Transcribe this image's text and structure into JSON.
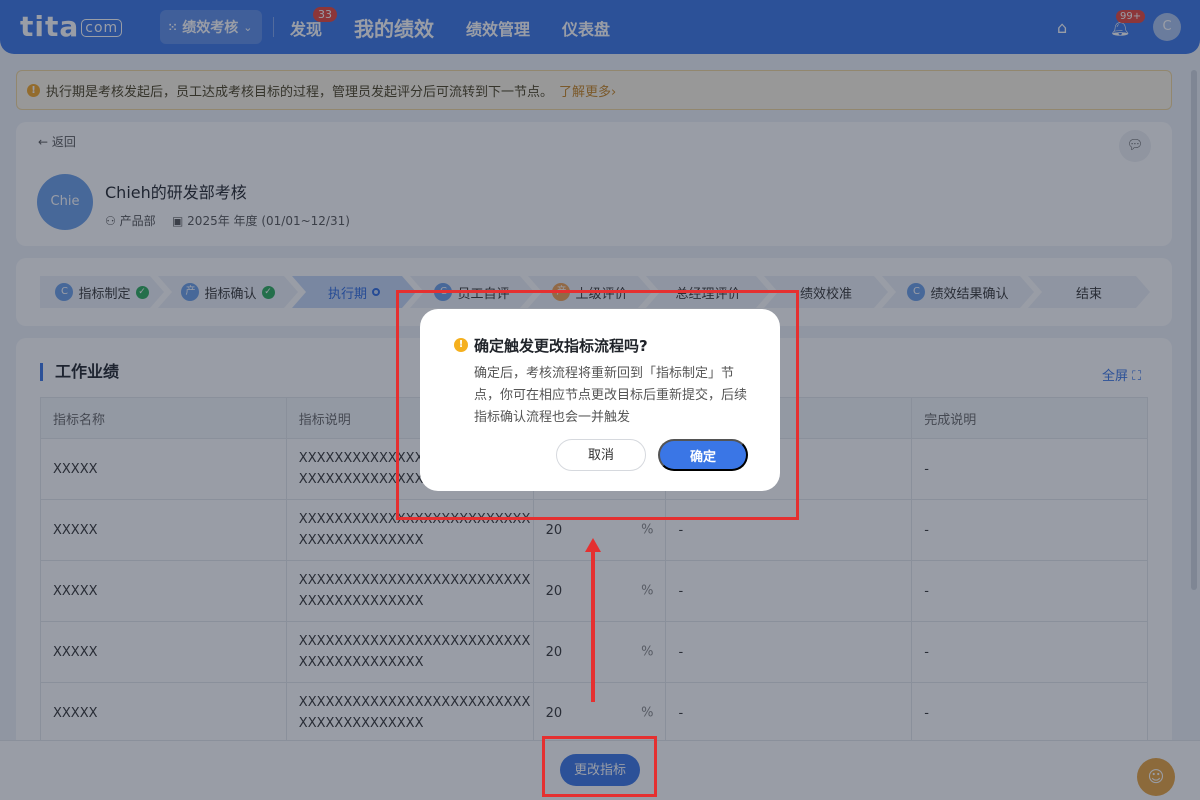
{
  "header": {
    "logo": "tita",
    "logo_suffix": "com",
    "module": "绩效考核",
    "nav": [
      "发现",
      "我的绩效",
      "绩效管理",
      "仪表盘"
    ],
    "discover_badge": "33",
    "bell_badge": "99+",
    "user_initial": "C"
  },
  "notice": {
    "text": "执行期是考核发起后，员工达成考核目标的过程，管理员发起评分后可流转到下一节点。",
    "link": "了解更多"
  },
  "info": {
    "back": "返回",
    "avatar": "Chie",
    "title": "Chieh的研发部考核",
    "department": "产品部",
    "period": "2025年 年度 (01/01~12/31)"
  },
  "steps": [
    {
      "label": "指标制定",
      "avatar": "C",
      "status": "done"
    },
    {
      "label": "指标确认",
      "avatar": "产",
      "status": "done"
    },
    {
      "label": "执行期",
      "avatar": "",
      "status": "current"
    },
    {
      "label": "员工自评",
      "avatar": "C",
      "status": ""
    },
    {
      "label": "上级评价",
      "avatar": "产",
      "status": ""
    },
    {
      "label": "总经理评价",
      "avatar": "",
      "status": ""
    },
    {
      "label": "绩效校准",
      "avatar": "",
      "status": ""
    },
    {
      "label": "绩效结果确认",
      "avatar": "C",
      "status": ""
    },
    {
      "label": "结束",
      "avatar": "",
      "status": ""
    }
  ],
  "section": {
    "title": "工作业绩",
    "fullscreen": "全屏"
  },
  "table": {
    "columns": [
      "指标名称",
      "指标说明",
      "",
      "",
      "完成说明"
    ],
    "rows": [
      {
        "name": "XXXXX",
        "desc": "XXXXXXXXXXXXXXXXXXXXXXXXXXXXXXXXXXXXXXXX",
        "weight": "",
        "unit": "",
        "result": "-",
        "note": "-"
      },
      {
        "name": "XXXXX",
        "desc": "XXXXXXXXXXXXXXXXXXXXXXXXXXXXXXXXXXXXXXXX",
        "weight": "20",
        "unit": "%",
        "result": "-",
        "note": "-"
      },
      {
        "name": "XXXXX",
        "desc": "XXXXXXXXXXXXXXXXXXXXXXXXXXXXXXXXXXXXXXXX",
        "weight": "20",
        "unit": "%",
        "result": "-",
        "note": "-"
      },
      {
        "name": "XXXXX",
        "desc": "XXXXXXXXXXXXXXXXXXXXXXXXXXXXXXXXXXXXXXXX",
        "weight": "20",
        "unit": "%",
        "result": "-",
        "note": "-"
      },
      {
        "name": "XXXXX",
        "desc": "XXXXXXXXXXXXXXXXXXXXXXXXXXXXXXXXXXXXXXXX",
        "weight": "20",
        "unit": "%",
        "result": "-",
        "note": "-"
      }
    ]
  },
  "bottom": {
    "change_button": "更改指标"
  },
  "dialog": {
    "title": "确定触发更改指标流程吗?",
    "body": "确定后，考核流程将重新回到「指标制定」节点，你可在相应节点更改目标后重新提交，后续指标确认流程也会一并触发",
    "cancel": "取消",
    "confirm": "确定"
  },
  "colors": {
    "primary": "#3a76e6",
    "annotation": "#e53030",
    "warning": "#f5a623"
  }
}
